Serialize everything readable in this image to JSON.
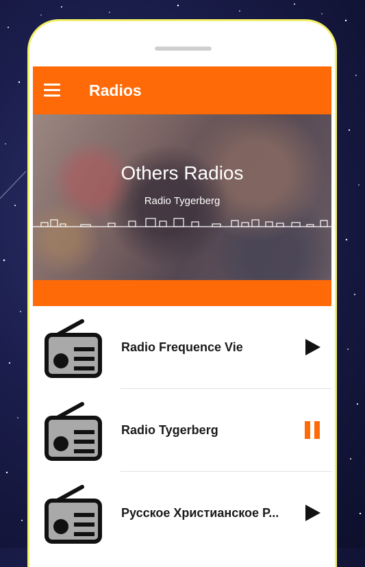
{
  "app": {
    "title": "Radios"
  },
  "player": {
    "title": "Others Radios",
    "subtitle": "Radio Tygerberg"
  },
  "stations": [
    {
      "name": "Radio Frequence Vie",
      "state": "play-icon"
    },
    {
      "name": "Radio Tygerberg",
      "state": "pause-icon"
    },
    {
      "name": "Русское Христианское Р...",
      "state": "play-icon"
    }
  ],
  "colors": {
    "accent": "#ff6a08",
    "frame": "#f3f06a",
    "icon_fill": "#a9a9a9"
  }
}
